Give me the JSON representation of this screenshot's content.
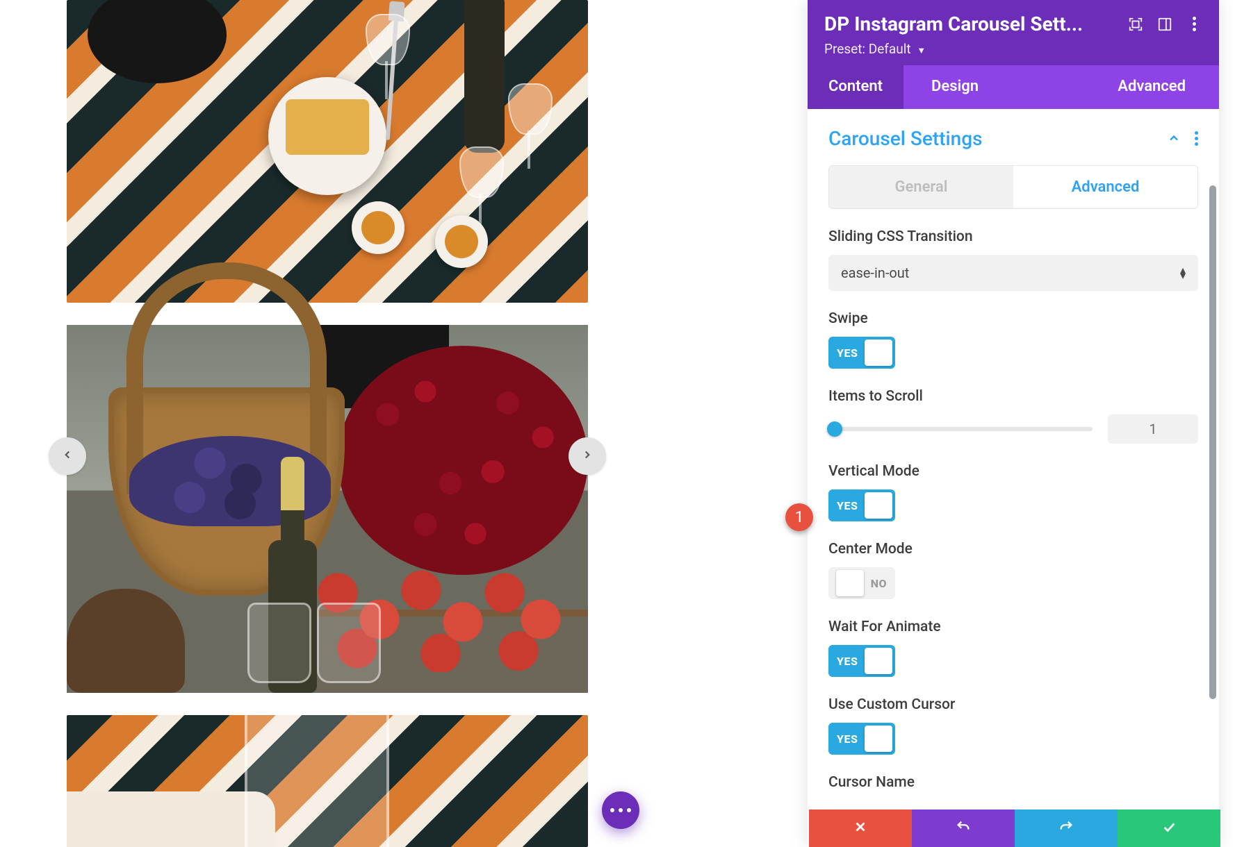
{
  "panel": {
    "title": "DP Instagram Carousel Sett...",
    "preset_label": "Preset:",
    "preset_value": "Default",
    "tabs": {
      "content": "Content",
      "design": "Design",
      "advanced": "Advanced"
    }
  },
  "section": {
    "title": "Carousel Settings",
    "subtabs": {
      "general": "General",
      "advanced": "Advanced"
    }
  },
  "fields": {
    "transition": {
      "label": "Sliding CSS Transition",
      "value": "ease-in-out"
    },
    "swipe": {
      "label": "Swipe",
      "on": "YES"
    },
    "items": {
      "label": "Items to Scroll",
      "value": "1"
    },
    "vertical": {
      "label": "Vertical Mode",
      "on": "YES"
    },
    "center": {
      "label": "Center Mode",
      "off": "NO"
    },
    "wait": {
      "label": "Wait For Animate",
      "on": "YES"
    },
    "cursor": {
      "label": "Use Custom Cursor",
      "on": "YES"
    },
    "cursorName": {
      "label": "Cursor Name"
    }
  },
  "callout": {
    "n1": "1"
  }
}
